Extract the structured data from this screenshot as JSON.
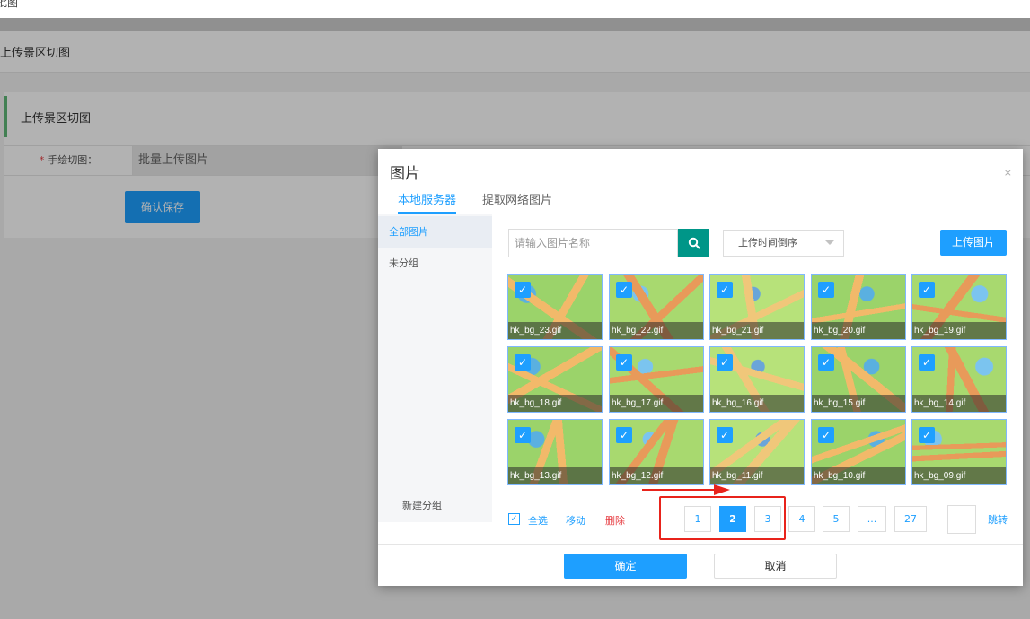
{
  "page": {
    "crumb": "批图",
    "header_title": "上传景区切图",
    "panel_title": "上传景区切图",
    "form_label": "手绘切图：",
    "form_required": "*",
    "batch_upload": "批量上传图片",
    "save_button": "确认保存"
  },
  "modal": {
    "title": "图片",
    "close": "×",
    "tabs": [
      "本地服务器",
      "提取网络图片"
    ],
    "sidebar": {
      "items": [
        "全部图片",
        "未分组"
      ],
      "new_group": "新建分组"
    },
    "search_placeholder": "请输入图片名称",
    "sort_value": "上传时间倒序",
    "upload_button": "上传图片",
    "images": [
      "hk_bg_23.gif",
      "hk_bg_22.gif",
      "hk_bg_21.gif",
      "hk_bg_20.gif",
      "hk_bg_19.gif",
      "hk_bg_18.gif",
      "hk_bg_17.gif",
      "hk_bg_16.gif",
      "hk_bg_15.gif",
      "hk_bg_14.gif",
      "hk_bg_13.gif",
      "hk_bg_12.gif",
      "hk_bg_11.gif",
      "hk_bg_10.gif",
      "hk_bg_09.gif"
    ],
    "tools": {
      "select_all": "全选",
      "move": "移动",
      "delete": "删除"
    },
    "pagination": {
      "pages": [
        "1",
        "2",
        "3",
        "4",
        "5",
        "...",
        "27"
      ],
      "current": "2",
      "jump": "跳转"
    },
    "ok_button": "确定",
    "cancel_button": "取消"
  },
  "colors": {
    "accent": "#1e9fff",
    "search_button": "#009688",
    "danger": "#e6393e",
    "annotation": "#e8231b"
  }
}
